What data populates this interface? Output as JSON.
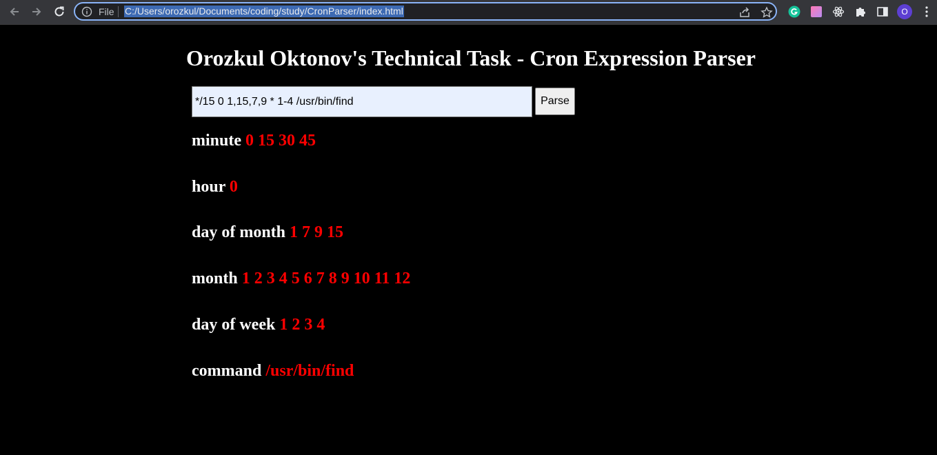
{
  "browser": {
    "scheme_label": "File",
    "url": "C:/Users/orozkul/Documents/coding/study/CronParser/index.html",
    "profile_initial": "O",
    "accent_color": "#8ab4f8"
  },
  "page": {
    "title": "Orozkul Oktonov's Technical Task - Cron Expression Parser",
    "input_value": "*/15 0 1,15,7,9 * 1-4 /usr/bin/find",
    "parse_button_label": "Parse",
    "label_color": "#ffffff",
    "value_color": "#ff0000",
    "results": [
      {
        "label": "minute",
        "value": "0 15 30 45"
      },
      {
        "label": "hour",
        "value": "0"
      },
      {
        "label": "day of month",
        "value": "1 7 9 15"
      },
      {
        "label": "month",
        "value": "1 2 3 4 5 6 7 8 9 10 11 12"
      },
      {
        "label": "day of week",
        "value": "1 2 3 4"
      },
      {
        "label": "command",
        "value": "/usr/bin/find"
      }
    ]
  },
  "icons": [
    "back-arrow-icon",
    "forward-arrow-icon",
    "reload-icon",
    "info-icon",
    "share-icon",
    "star-icon",
    "grammarly-icon",
    "gradient-extension-icon",
    "react-devtools-icon",
    "puzzle-icon",
    "side-panel-icon",
    "kebab-menu-icon"
  ]
}
